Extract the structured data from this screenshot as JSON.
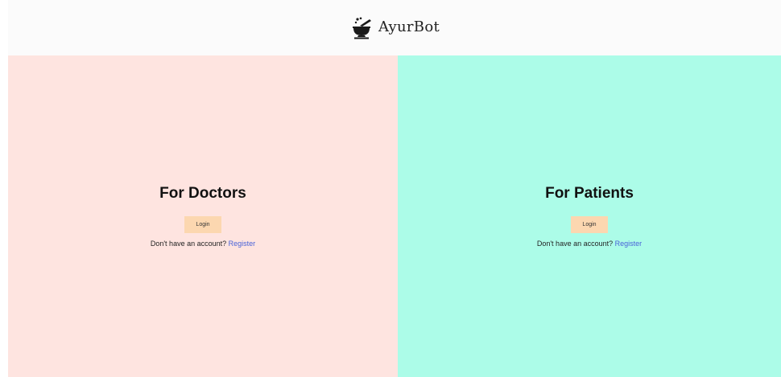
{
  "header": {
    "brand_name": "AyurBot",
    "logo_icon": "mortar-pestle-icon"
  },
  "doctors": {
    "title": "For Doctors",
    "login_label": "Login",
    "register_prompt": "Don't have an account?",
    "register_link": "Register"
  },
  "patients": {
    "title": "For Patients",
    "login_label": "Login",
    "register_prompt": "Don't have an account?",
    "register_link": "Register"
  },
  "colors": {
    "header_bg": "#fbfbfb",
    "doctors_bg": "#fee4e0",
    "patients_bg": "#acfce8",
    "button_bg": "#fcd7b0",
    "link": "#4a63d8"
  }
}
